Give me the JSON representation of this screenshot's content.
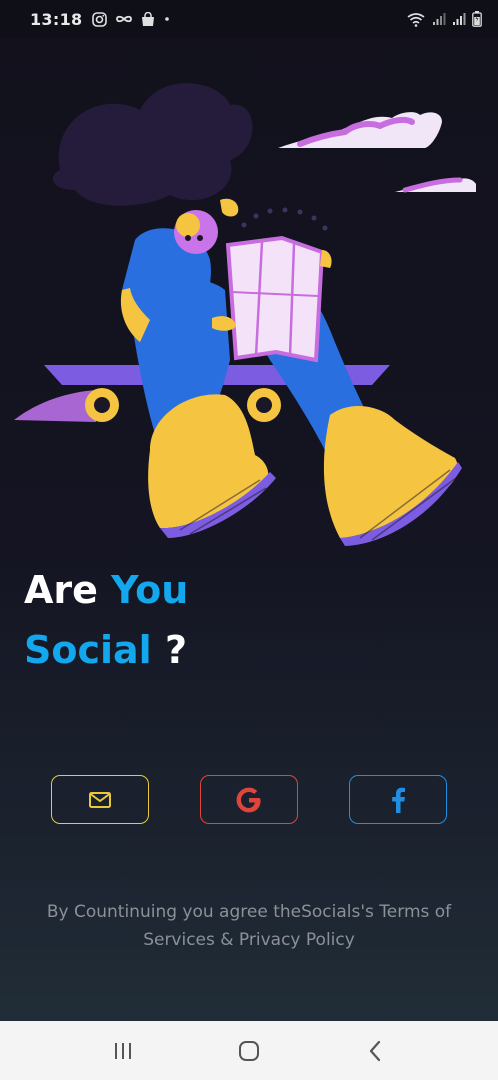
{
  "status_bar": {
    "time": "13:18",
    "left_icons": [
      "instagram-icon",
      "infinity-icon",
      "shopping-bag-icon",
      "dot-icon"
    ],
    "right_icons": [
      "wifi-icon",
      "signal-icon",
      "signal-icon",
      "battery-icon"
    ]
  },
  "headline": {
    "line1_word1": "Are",
    "line1_word2": "You",
    "line2_word1": "Social",
    "line2_word2": "?"
  },
  "auth_buttons": [
    {
      "provider": "email",
      "icon": "mail-icon",
      "color": "#e8c93a"
    },
    {
      "provider": "google",
      "icon": "google-icon",
      "color": "#e0443a"
    },
    {
      "provider": "facebook",
      "icon": "facebook-icon",
      "color": "#1f8fe6"
    }
  ],
  "terms": {
    "text": "By Countinuing you agree theSocials's Terms of Services & Privacy Policy"
  },
  "nav_bar": {
    "buttons": [
      "recent-apps-icon",
      "home-icon",
      "back-icon"
    ]
  },
  "colors": {
    "accent_blue": "#13a8ee",
    "background_top": "#12111c",
    "background_bottom": "#22303a"
  }
}
